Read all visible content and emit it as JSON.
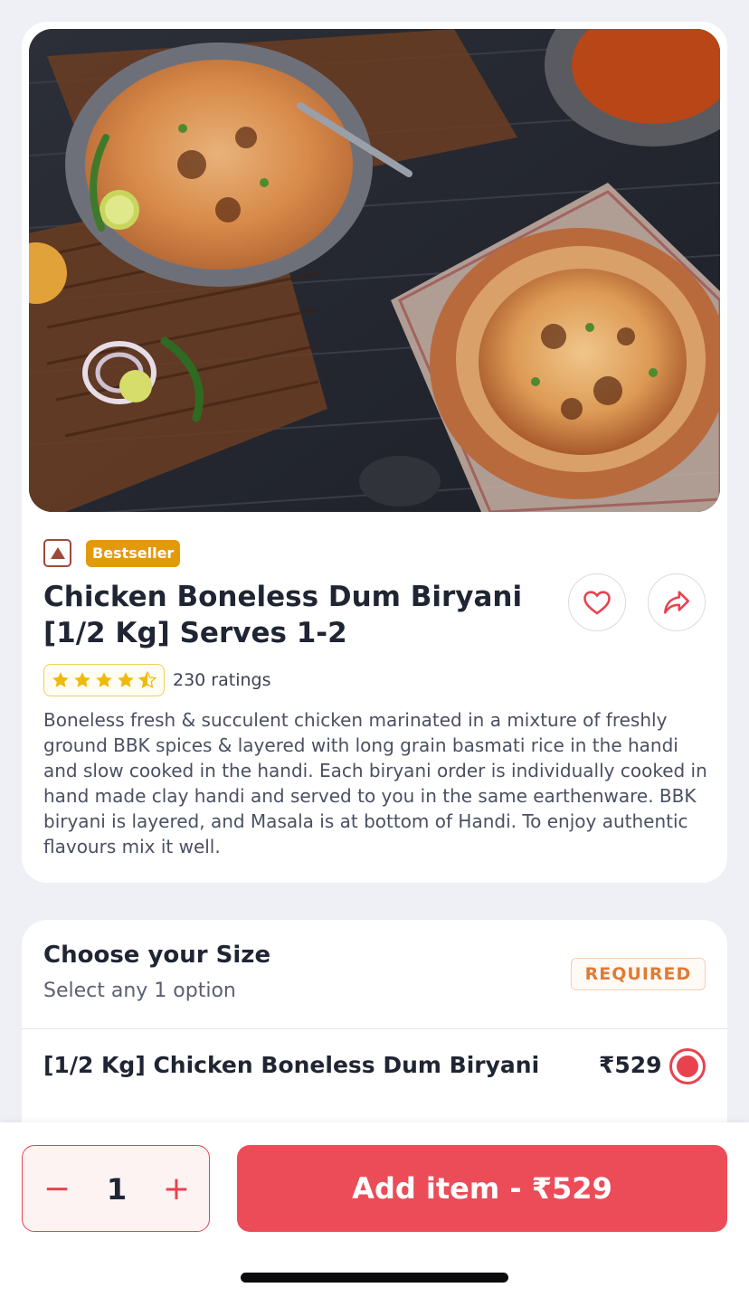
{
  "item": {
    "badge": "Bestseller",
    "title": "Chicken Boneless Dum Biryani [1/2 Kg] Serves 1-2",
    "rating_value": 4.5,
    "ratings_count": "230 ratings",
    "description": "Boneless fresh & succulent chicken marinated in a mixture of freshly ground BBK spices & layered with long grain basmati rice in the handi and slow cooked in the handi. Each biryani order is individually cooked in hand made clay handi and served to you in the same earthenware. BBK biryani is layered, and Masala is at bottom of Handi. To enjoy authentic flavours mix it well.",
    "diet_icon": "non-veg-icon"
  },
  "size": {
    "title": "Choose your Size",
    "subtitle": "Select any 1 option",
    "required": "REQUIRED",
    "option_label": "[1/2 Kg] Chicken Boneless Dum Biryani",
    "option_price": "₹529",
    "option_selected": true
  },
  "footer": {
    "minus": "−",
    "quantity": "1",
    "plus": "+",
    "add_label": "Add item - ₹529"
  },
  "colors": {
    "accent": "#ec4c58",
    "bestseller": "#e29a0c",
    "required": "#e17a35",
    "star": "#f0b90b"
  }
}
